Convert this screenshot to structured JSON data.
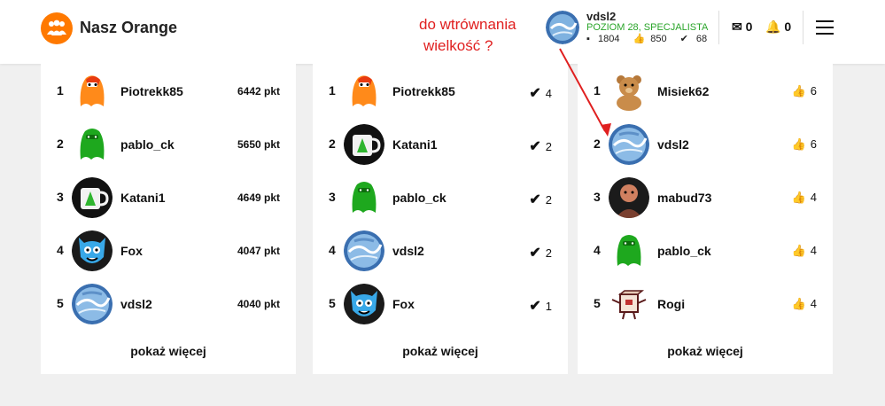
{
  "header": {
    "brand": "Nasz Orange",
    "annotation_line1": "do wtrównania",
    "annotation_line2": "wielkość ?",
    "user": {
      "name": "vdsl2",
      "level": "POZIOM 28, SPECJALISTA",
      "comments": "1804",
      "likes": "850",
      "solutions": "68"
    },
    "messages_count": "0",
    "notifications_count": "0"
  },
  "panels": [
    {
      "rows": [
        {
          "rank": "1",
          "name": "Piotrekk85",
          "value": "6442 pkt",
          "avatar": "orange-monster"
        },
        {
          "rank": "2",
          "name": "pablo_ck",
          "value": "5650 pkt",
          "avatar": "green-monster"
        },
        {
          "rank": "3",
          "name": "Katani1",
          "value": "4649 pkt",
          "avatar": "mug"
        },
        {
          "rank": "4",
          "name": "Fox",
          "value": "4047 pkt",
          "avatar": "blue-creature"
        },
        {
          "rank": "5",
          "name": "vdsl2",
          "value": "4040 pkt",
          "avatar": "earth"
        }
      ],
      "more": "pokaż więcej"
    },
    {
      "rows": [
        {
          "rank": "1",
          "name": "Piotrekk85",
          "value": "4",
          "avatar": "orange-monster"
        },
        {
          "rank": "2",
          "name": "Katani1",
          "value": "2",
          "avatar": "mug"
        },
        {
          "rank": "3",
          "name": "pablo_ck",
          "value": "2",
          "avatar": "green-monster"
        },
        {
          "rank": "4",
          "name": "vdsl2",
          "value": "2",
          "avatar": "earth"
        },
        {
          "rank": "5",
          "name": "Fox",
          "value": "1",
          "avatar": "blue-creature"
        }
      ],
      "more": "pokaż więcej"
    },
    {
      "rows": [
        {
          "rank": "1",
          "name": "Misiek62",
          "value": "6",
          "avatar": "teddy-bear"
        },
        {
          "rank": "2",
          "name": "vdsl2",
          "value": "6",
          "avatar": "earth"
        },
        {
          "rank": "3",
          "name": "mabud73",
          "value": "4",
          "avatar": "portrait"
        },
        {
          "rank": "4",
          "name": "pablo_ck",
          "value": "4",
          "avatar": "green-monster"
        },
        {
          "rank": "5",
          "name": "Rogi",
          "value": "4",
          "avatar": "box-character"
        }
      ],
      "more": "pokaż więcej"
    }
  ],
  "colors": {
    "brand": "#ff7900",
    "annotation": "#e02020",
    "level": "#2aa52a"
  }
}
